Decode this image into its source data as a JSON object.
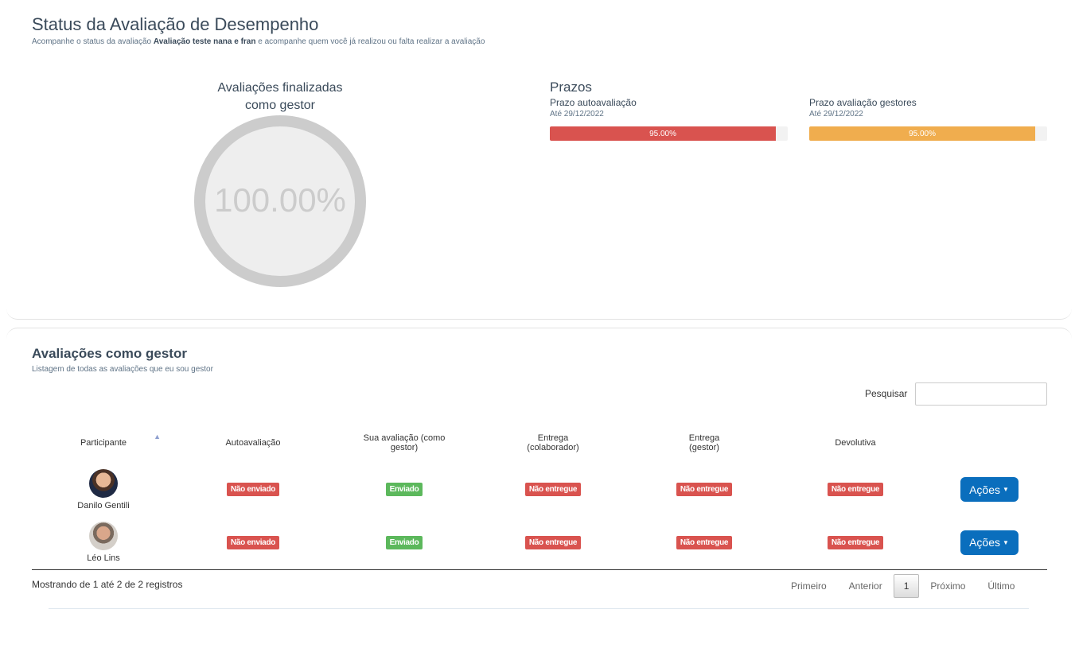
{
  "header": {
    "title": "Status da Avaliação de Desempenho",
    "subtitle_prefix": "Acompanhe o status da avaliação ",
    "subtitle_bold": "Avaliação teste nana e fran",
    "subtitle_suffix": " e acompanhe quem você já realizou ou falta realizar a avaliação"
  },
  "donut": {
    "title": "Avaliações finalizadas como gestor",
    "value_label": "100.00%",
    "percent": 100
  },
  "prazos": {
    "title": "Prazos",
    "items": [
      {
        "label": "Prazo autoavaliação",
        "date": "Até 29/12/2022",
        "percent": 95,
        "percent_label": "95.00%",
        "color": "#d9534f"
      },
      {
        "label": "Prazo avaliação gestores",
        "date": "Até 29/12/2022",
        "percent": 95,
        "percent_label": "95.00%",
        "color": "#f0ad4e"
      }
    ]
  },
  "section": {
    "title": "Avaliações como gestor",
    "subtitle": "Listagem de todas as avaliações que eu sou gestor"
  },
  "search": {
    "label": "Pesquisar",
    "value": ""
  },
  "table": {
    "columns": [
      "Participante",
      "Autoavaliação",
      "Sua avaliação (como gestor)",
      "Entrega (colaborador)",
      "Entrega (gestor)",
      "Devolutiva",
      ""
    ],
    "sort_icon": "sort-asc-icon",
    "rows": [
      {
        "name": "Danilo Gentili",
        "auto": "Não enviado",
        "sua": "Enviado",
        "entrega_colab": "Não entregue",
        "entrega_gestor": "Não entregue",
        "devolutiva": "Não entregue",
        "action": "Ações"
      },
      {
        "name": "Léo Lins",
        "auto": "Não enviado",
        "sua": "Enviado",
        "entrega_colab": "Não entregue",
        "entrega_gestor": "Não entregue",
        "devolutiva": "Não entregue",
        "action": "Ações"
      }
    ]
  },
  "footer": {
    "info": "Mostrando de 1 até 2 de 2 registros",
    "pager": {
      "first": "Primeiro",
      "prev": "Anterior",
      "current": "1",
      "next": "Próximo",
      "last": "Último"
    }
  },
  "colors": {
    "danger": "#d9534f",
    "success": "#5cb85c",
    "warning": "#f0ad4e",
    "primary": "#0a6ebd"
  }
}
